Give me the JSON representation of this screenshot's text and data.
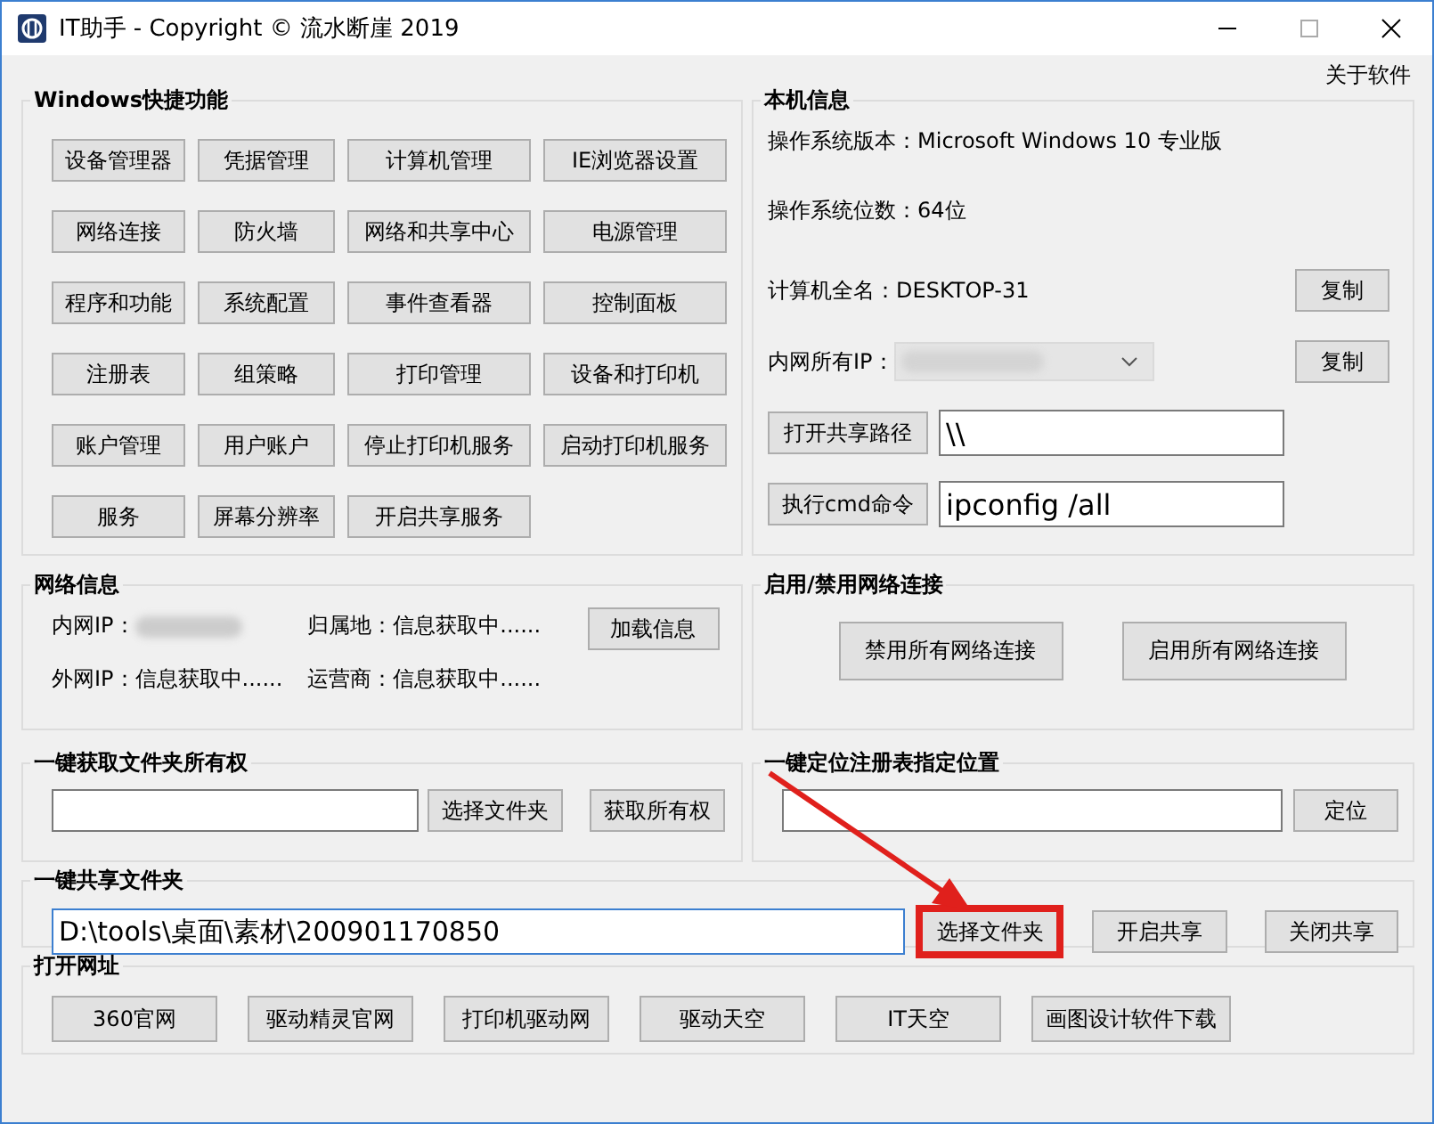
{
  "window": {
    "title": "IT助手 - Copyright © 流水断崖 2019"
  },
  "about_link": "关于软件",
  "windows_shortcuts": {
    "title": "Windows快捷功能",
    "buttons": [
      "设备管理器",
      "凭据管理",
      "计算机管理",
      "IE浏览器设置",
      "网络连接",
      "防火墙",
      "网络和共享中心",
      "电源管理",
      "程序和功能",
      "系统配置",
      "事件查看器",
      "控制面板",
      "注册表",
      "组策略",
      "打印管理",
      "设备和打印机",
      "账户管理",
      "用户账户",
      "停止打印机服务",
      "启动打印机服务",
      "服务",
      "屏幕分辨率",
      "开启共享服务"
    ]
  },
  "machine_info": {
    "title": "本机信息",
    "os_version": "操作系统版本：Microsoft Windows 10 专业版",
    "os_bits": "操作系统位数：64位",
    "computer_name": "计算机全名：DESKTOP-31",
    "copy_buttons": [
      "复制",
      "复制"
    ],
    "lan_ip_label": "内网所有IP：",
    "share_path": {
      "button": "打开共享路径",
      "value": "\\\\"
    },
    "cmd": {
      "button": "执行cmd命令",
      "value": "ipconfig /all"
    }
  },
  "network_info": {
    "title": "网络信息",
    "lan_ip_label": "内网IP：",
    "location": "归属地：信息获取中......",
    "wan_ip": "外网IP：信息获取中......",
    "isp": "运营商：信息获取中......",
    "load_button": "加载信息"
  },
  "network_toggle": {
    "title": "启用/禁用网络连接",
    "buttons": [
      "禁用所有网络连接",
      "启用所有网络连接"
    ]
  },
  "folder_ownership": {
    "title": "一键获取文件夹所有权",
    "buttons": [
      "选择文件夹",
      "获取所有权"
    ]
  },
  "registry_locate": {
    "title": "一键定位注册表指定位置",
    "button": "定位"
  },
  "share_folder": {
    "title": "一键共享文件夹",
    "path": "D:\\tools\\桌面\\素材\\200901170850",
    "buttons": [
      {
        "label": "选择文件夹",
        "highlighted": true
      },
      {
        "label": "开启共享",
        "highlighted": false
      },
      {
        "label": "关闭共享",
        "highlighted": false
      }
    ]
  },
  "open_urls": {
    "title": "打开网址",
    "buttons": [
      "360官网",
      "驱动精灵官网",
      "打印机驱动网",
      "驱动天空",
      "IT天空",
      "画图设计软件下载"
    ]
  }
}
